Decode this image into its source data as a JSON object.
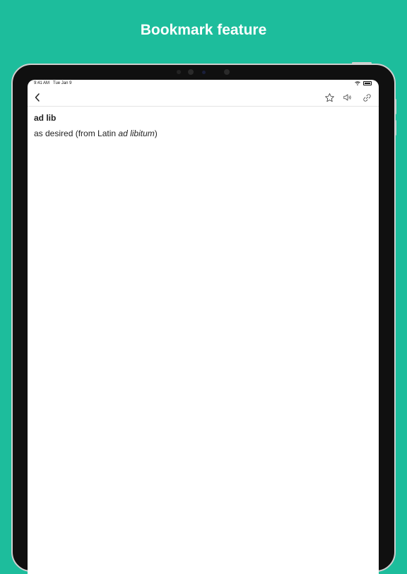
{
  "headline": "Bookmark feature",
  "status_bar": {
    "time": "9:41 AM",
    "date": "Tue Jan 9"
  },
  "nav": {
    "icons": {
      "back": "chevron-left-icon",
      "bookmark": "star-icon",
      "pronounce": "speaker-icon",
      "share": "link-icon"
    }
  },
  "entry": {
    "term": "ad lib",
    "definition_prefix": "as desired (from Latin ",
    "definition_italic": "ad libitum",
    "definition_suffix": ")"
  },
  "colors": {
    "background": "#1dbd9c",
    "device_bezel": "#101010",
    "screen": "#ffffff",
    "text": "#222222"
  }
}
